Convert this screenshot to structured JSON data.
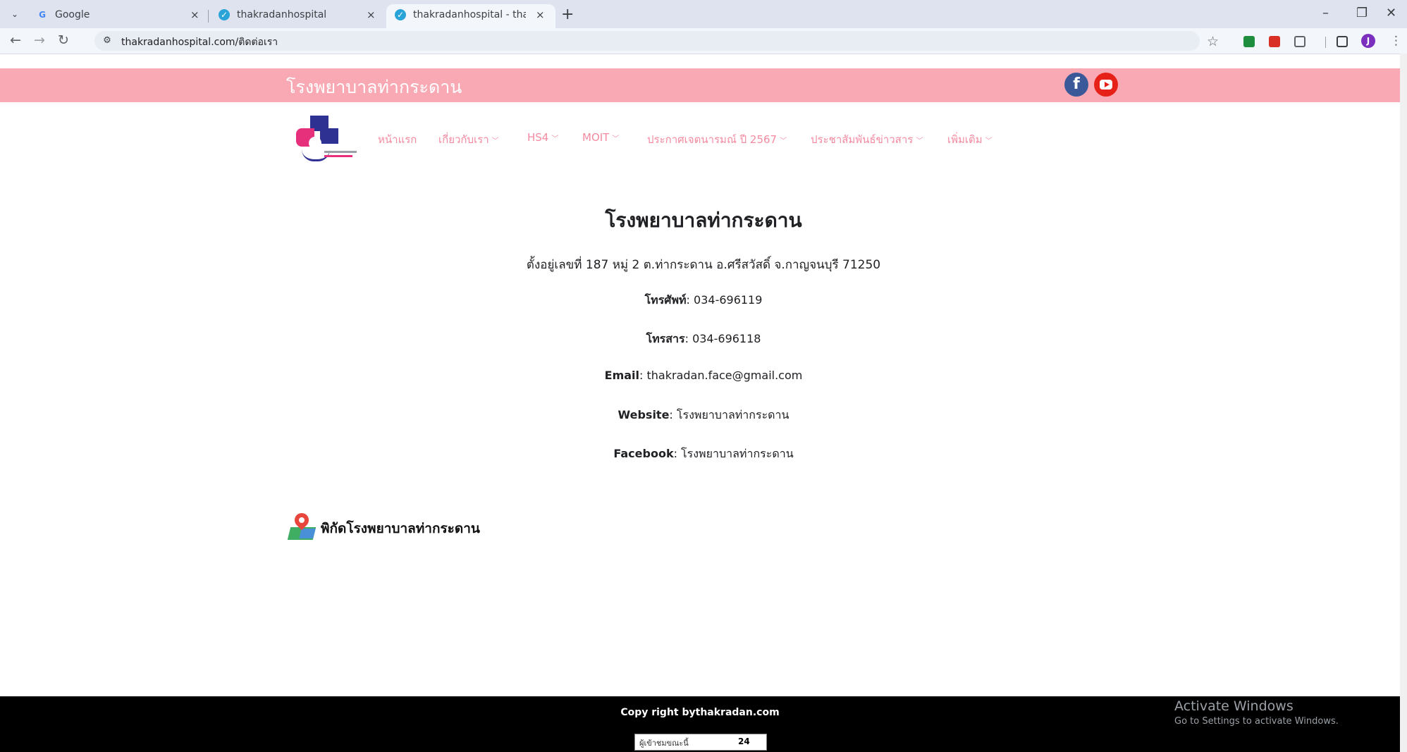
{
  "browser": {
    "tabs": [
      {
        "title": "Google",
        "favicon": "G",
        "active": false
      },
      {
        "title": "thakradanhospital",
        "favicon": "hospital-favicon",
        "active": false
      },
      {
        "title": "thakradanhospital - thakradan",
        "favicon": "hospital-favicon",
        "active": true
      }
    ],
    "url": "thakradanhospital.com/ติดต่อเรา"
  },
  "site": {
    "top_title": "โรงพยาบาลท่ากระดาน",
    "nav": [
      {
        "label": "หน้าแรก",
        "dropdown": false
      },
      {
        "label": "เกี่ยวกับเรา",
        "dropdown": true
      },
      {
        "label": "HS4",
        "dropdown": true
      },
      {
        "label": "MOIT",
        "dropdown": true
      },
      {
        "label": "ประกาศเจตนารมณ์ ปี 2567",
        "dropdown": true
      },
      {
        "label": "ประชาสัมพันธ์ข่าวสาร",
        "dropdown": true
      },
      {
        "label": "เพิ่มเติม",
        "dropdown": true
      }
    ],
    "social": {
      "facebook": "f"
    }
  },
  "contact": {
    "heading": "โรงพยาบาลท่ากระดาน",
    "address": "ตั้งอยู่เลขที่ 187 หมู่ 2 ต.ท่ากระดาน อ.ศรีสวัสดิ์ จ.กาญจนบุรี 71250",
    "phone_label": "โทรศัพท์",
    "phone": ": 034-696119",
    "fax_label": "โทรสาร",
    "fax": ": 034-696118",
    "email_label": "Email",
    "email": ": thakradan.face@gmail.com",
    "website_label": "Website",
    "website": ": โรงพยาบาลท่ากระดาน",
    "facebook_label": "Facebook",
    "facebook": ": โรงพยาบาลท่ากระดาน",
    "map_title": "พิกัดโรงพยาบาลท่ากระดาน"
  },
  "footer": {
    "copyright": "Copy right bythakradan.com",
    "counter_label": "ผู้เข้าชมขณะนี้",
    "counter_value": "24"
  },
  "watermark": {
    "line1": "Activate Windows",
    "line2": "Go to Settings to activate Windows."
  }
}
